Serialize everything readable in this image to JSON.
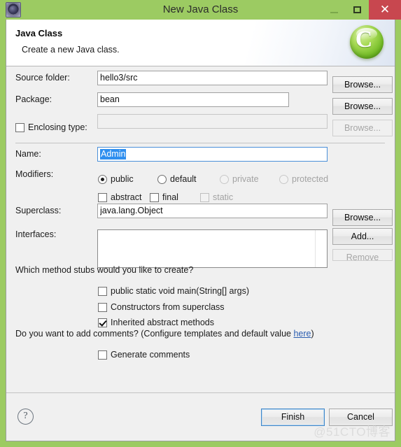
{
  "window": {
    "title": "New Java Class",
    "icon": "gear-icon",
    "controls": {
      "minimize": "–",
      "maximize": "□",
      "close": "✕"
    }
  },
  "banner": {
    "title": "Java Class",
    "subtitle": "Create a new Java class.",
    "logo_letter": "C"
  },
  "form": {
    "source_folder": {
      "label": "Source folder:",
      "value": "hello3/src",
      "button": "Browse..."
    },
    "package": {
      "label": "Package:",
      "value": "bean",
      "button": "Browse..."
    },
    "enclosing_type": {
      "label": "Enclosing type:",
      "checked": false,
      "value": "",
      "button": "Browse..."
    },
    "name": {
      "label": "Name:",
      "value": "Admin",
      "selected": true
    },
    "modifiers": {
      "label": "Modifiers:",
      "radios": [
        {
          "label": "public",
          "checked": true,
          "disabled": false
        },
        {
          "label": "default",
          "checked": false,
          "disabled": false
        },
        {
          "label": "private",
          "checked": false,
          "disabled": true
        },
        {
          "label": "protected",
          "checked": false,
          "disabled": true
        }
      ],
      "checkboxes": [
        {
          "label": "abstract",
          "checked": false,
          "disabled": false
        },
        {
          "label": "final",
          "checked": false,
          "disabled": false
        },
        {
          "label": "static",
          "checked": false,
          "disabled": true
        }
      ]
    },
    "superclass": {
      "label": "Superclass:",
      "value": "java.lang.Object",
      "button": "Browse..."
    },
    "interfaces": {
      "label": "Interfaces:",
      "items": [],
      "add_button": "Add...",
      "remove_button": "Remove"
    },
    "method_stubs": {
      "question": "Which method stubs would you like to create?",
      "options": [
        {
          "label": "public static void main(String[] args)",
          "checked": false
        },
        {
          "label": "Constructors from superclass",
          "checked": false
        },
        {
          "label": "Inherited abstract methods",
          "checked": true
        }
      ]
    },
    "comments": {
      "question_prefix": "Do you want to add comments? (Configure templates and default value ",
      "link": "here",
      "question_suffix": ")",
      "option": {
        "label": "Generate comments",
        "checked": false
      }
    }
  },
  "footer": {
    "help_icon": "?",
    "finish": "Finish",
    "cancel": "Cancel"
  },
  "watermark": "@51CTO博客"
}
